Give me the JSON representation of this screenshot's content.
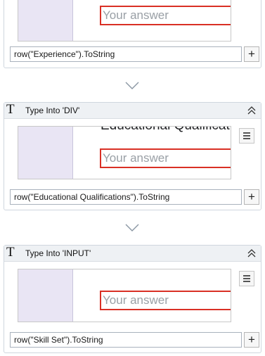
{
  "activities": [
    {
      "title": "",
      "expression": "row(\"Experience\").ToString",
      "preview_heading": "",
      "placeholder": "Your answer"
    },
    {
      "title": "Type Into 'DIV'",
      "expression": "row(\"Educational Qualifications\").ToString",
      "preview_heading": "Educational Qualifications",
      "placeholder": "Your answer"
    },
    {
      "title": "Type Into 'INPUT'",
      "expression": "row(\"Skill Set\").ToString",
      "preview_heading": "",
      "placeholder": "Your answer"
    }
  ],
  "icons": {
    "activity": "type-into-icon",
    "collapse": "chevron-double-up-icon",
    "menu": "hamburger-menu-icon",
    "add": "plus-icon",
    "connector": "chevron-down-icon"
  },
  "labels": {
    "type_glyph": "T",
    "plus": "+"
  },
  "colors": {
    "header_bg": "#eef1f4",
    "preview_left": "#e9e5f4",
    "answer_border": "#d93025",
    "placeholder": "#9aa0a6"
  }
}
